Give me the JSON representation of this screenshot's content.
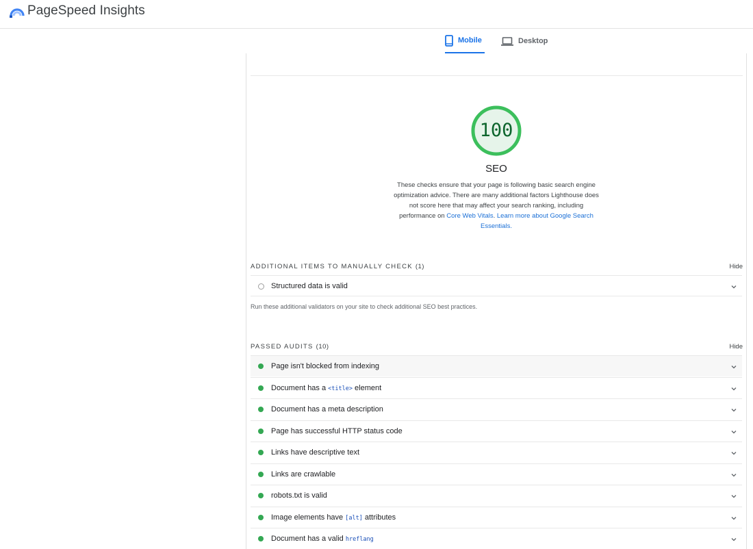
{
  "app": {
    "title": "PageSpeed Insights"
  },
  "tabs": [
    {
      "label": "Mobile",
      "icon": "phone-icon",
      "active": true
    },
    {
      "label": "Desktop",
      "icon": "laptop-icon",
      "active": false
    }
  ],
  "category": {
    "score": "100",
    "score_fraction": 1.0,
    "title": "SEO",
    "description_text": "These checks ensure that your page is following basic search engine optimization advice. There are many additional factors Lighthouse does not score here that may affect your search ranking, including performance on ",
    "link_core_web_vitals": "Core Web Vitals",
    "link_separator": ". ",
    "link_learn_more": "Learn more about Google Search Essentials",
    "description_end": "."
  },
  "manual": {
    "heading": "ADDITIONAL ITEMS TO MANUALLY CHECK",
    "count": "(1)",
    "hide_label": "Hide",
    "items": [
      {
        "title": "Structured data is valid"
      }
    ],
    "note": "Run these additional validators on your site to check additional SEO best practices."
  },
  "passed": {
    "heading": "PASSED AUDITS",
    "count": "(10)",
    "hide_label": "Hide",
    "items": [
      {
        "pre": "Page isn't blocked from indexing",
        "code": "",
        "post": ""
      },
      {
        "pre": "Document has a ",
        "code": "<title>",
        "post": " element"
      },
      {
        "pre": "Document has a meta description",
        "code": "",
        "post": ""
      },
      {
        "pre": "Page has successful HTTP status code",
        "code": "",
        "post": ""
      },
      {
        "pre": "Links have descriptive text",
        "code": "",
        "post": ""
      },
      {
        "pre": "Links are crawlable",
        "code": "",
        "post": ""
      },
      {
        "pre": "robots.txt is valid",
        "code": "",
        "post": ""
      },
      {
        "pre": "Image elements have ",
        "code": "[alt]",
        "post": " attributes"
      },
      {
        "pre": "Document has a valid ",
        "code": "hreflang",
        "post": ""
      }
    ]
  },
  "colors": {
    "accent": "#1a73e8",
    "pass": "#34a853",
    "gauge_ring": "#3cbf5c",
    "gauge_fill": "#e6f4ea"
  }
}
